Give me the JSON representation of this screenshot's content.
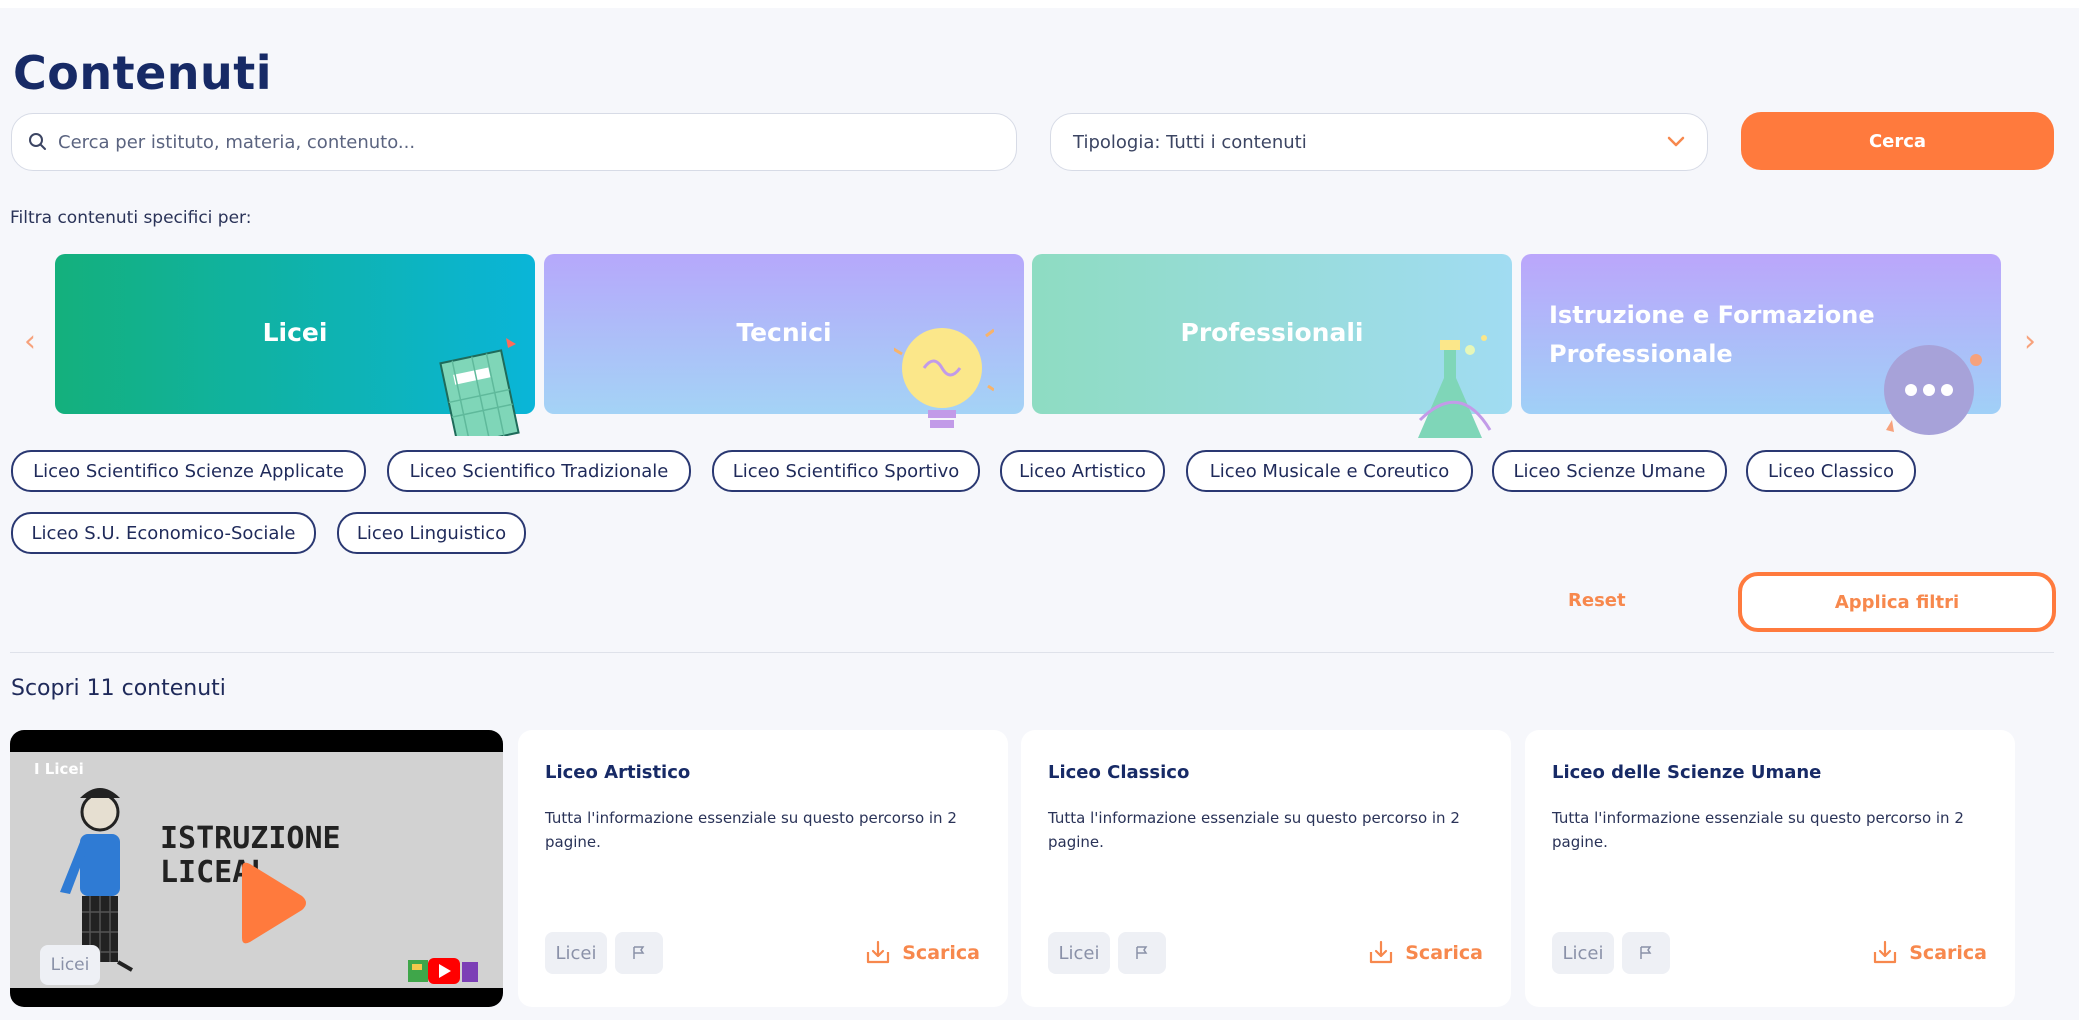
{
  "title": "Contenuti",
  "search": {
    "placeholder": "Cerca per istituto, materia, contenuto..."
  },
  "type_select": {
    "value": "Tipologia: Tutti i contenuti"
  },
  "search_button": "Cerca",
  "filter_label": "Filtra contenuti specifici per:",
  "categories": [
    {
      "label": "Licei"
    },
    {
      "label": "Tecnici"
    },
    {
      "label": "Professionali"
    },
    {
      "label_line1": "Istruzione e Formazione",
      "label_line2": "Professionale"
    }
  ],
  "chips": [
    "Liceo Scientifico Scienze Applicate",
    "Liceo Scientifico Tradizionale",
    "Liceo Scientifico Sportivo",
    "Liceo Artistico",
    "Liceo Musicale e Coreutico",
    "Liceo Scienze Umane",
    "Liceo Classico",
    "Liceo S.U. Economico-Sociale",
    "Liceo Linguistico"
  ],
  "reset_label": "Reset",
  "apply_label": "Applica filtri",
  "results_count_text": "Scopri 11 contenuti",
  "video": {
    "title": "I Licei",
    "thumb_text_line1": "ISTRUZIONE",
    "thumb_text_line2": "LICEAL",
    "tag": "Licei"
  },
  "result_cards": [
    {
      "title": "Liceo Artistico",
      "description": "Tutta l'informazione essenziale su questo percorso in 2 pagine.",
      "tag": "Licei",
      "download_label": "Scarica"
    },
    {
      "title": "Liceo Classico",
      "description": "Tutta l'informazione essenziale su questo percorso in 2 pagine.",
      "tag": "Licei",
      "download_label": "Scarica"
    },
    {
      "title": "Liceo delle Scienze Umane",
      "description": "Tutta l'informazione essenziale su questo percorso in 2 pagine.",
      "tag": "Licei",
      "download_label": "Scarica"
    }
  ],
  "colors": {
    "accent": "#ff7a3d",
    "navy": "#172a66",
    "background": "#f6f7fb"
  },
  "icons": {
    "search": "search-icon",
    "dropdown": "chevron-down-icon",
    "prev": "chevron-left-icon",
    "next": "chevron-right-icon",
    "flag": "flag-icon",
    "download": "download-icon",
    "play": "play-icon"
  }
}
